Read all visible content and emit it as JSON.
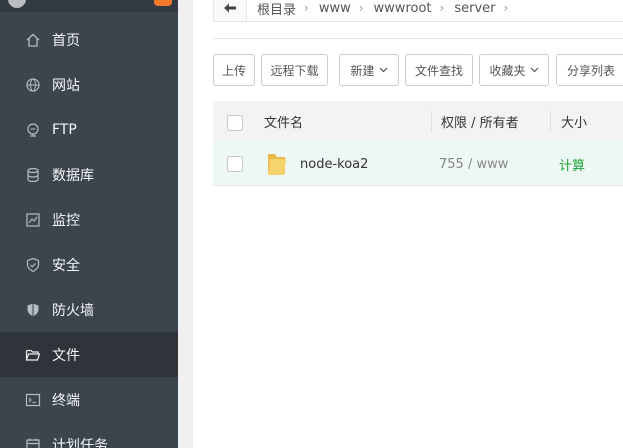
{
  "sidebar": {
    "items": [
      {
        "label": "首页",
        "icon": "home-icon"
      },
      {
        "label": "网站",
        "icon": "globe-icon"
      },
      {
        "label": "FTP",
        "icon": "ftp-icon"
      },
      {
        "label": "数据库",
        "icon": "database-icon"
      },
      {
        "label": "监控",
        "icon": "monitor-icon"
      },
      {
        "label": "安全",
        "icon": "shield-check-icon"
      },
      {
        "label": "防火墙",
        "icon": "firewall-shield-icon"
      },
      {
        "label": "文件",
        "icon": "folder-open-icon",
        "active": true
      },
      {
        "label": "终端",
        "icon": "terminal-icon"
      },
      {
        "label": "计划任务",
        "icon": "calendar-icon"
      }
    ]
  },
  "breadcrumb": {
    "back_icon": "arrow-left-icon",
    "items": [
      "根目录",
      "www",
      "wwwroot",
      "server"
    ]
  },
  "toolbar": {
    "upload": "上传",
    "remote_download": "远程下载",
    "new": "新建",
    "file_search": "文件查找",
    "favorites": "收藏夹",
    "share_list": "分享列表"
  },
  "table": {
    "headers": {
      "name": "文件名",
      "permissions": "权限 / 所有者",
      "size": "大小"
    },
    "rows": [
      {
        "name": "node-koa2",
        "permissions": "755 / www",
        "size": "计算"
      }
    ]
  },
  "colors": {
    "sidebar_bg": "#3c444d",
    "sidebar_active_bg": "#2e3439",
    "accent_green": "#20a53a",
    "row_highlight": "#edf7f3",
    "folder_yellow": "#f7d36b"
  }
}
